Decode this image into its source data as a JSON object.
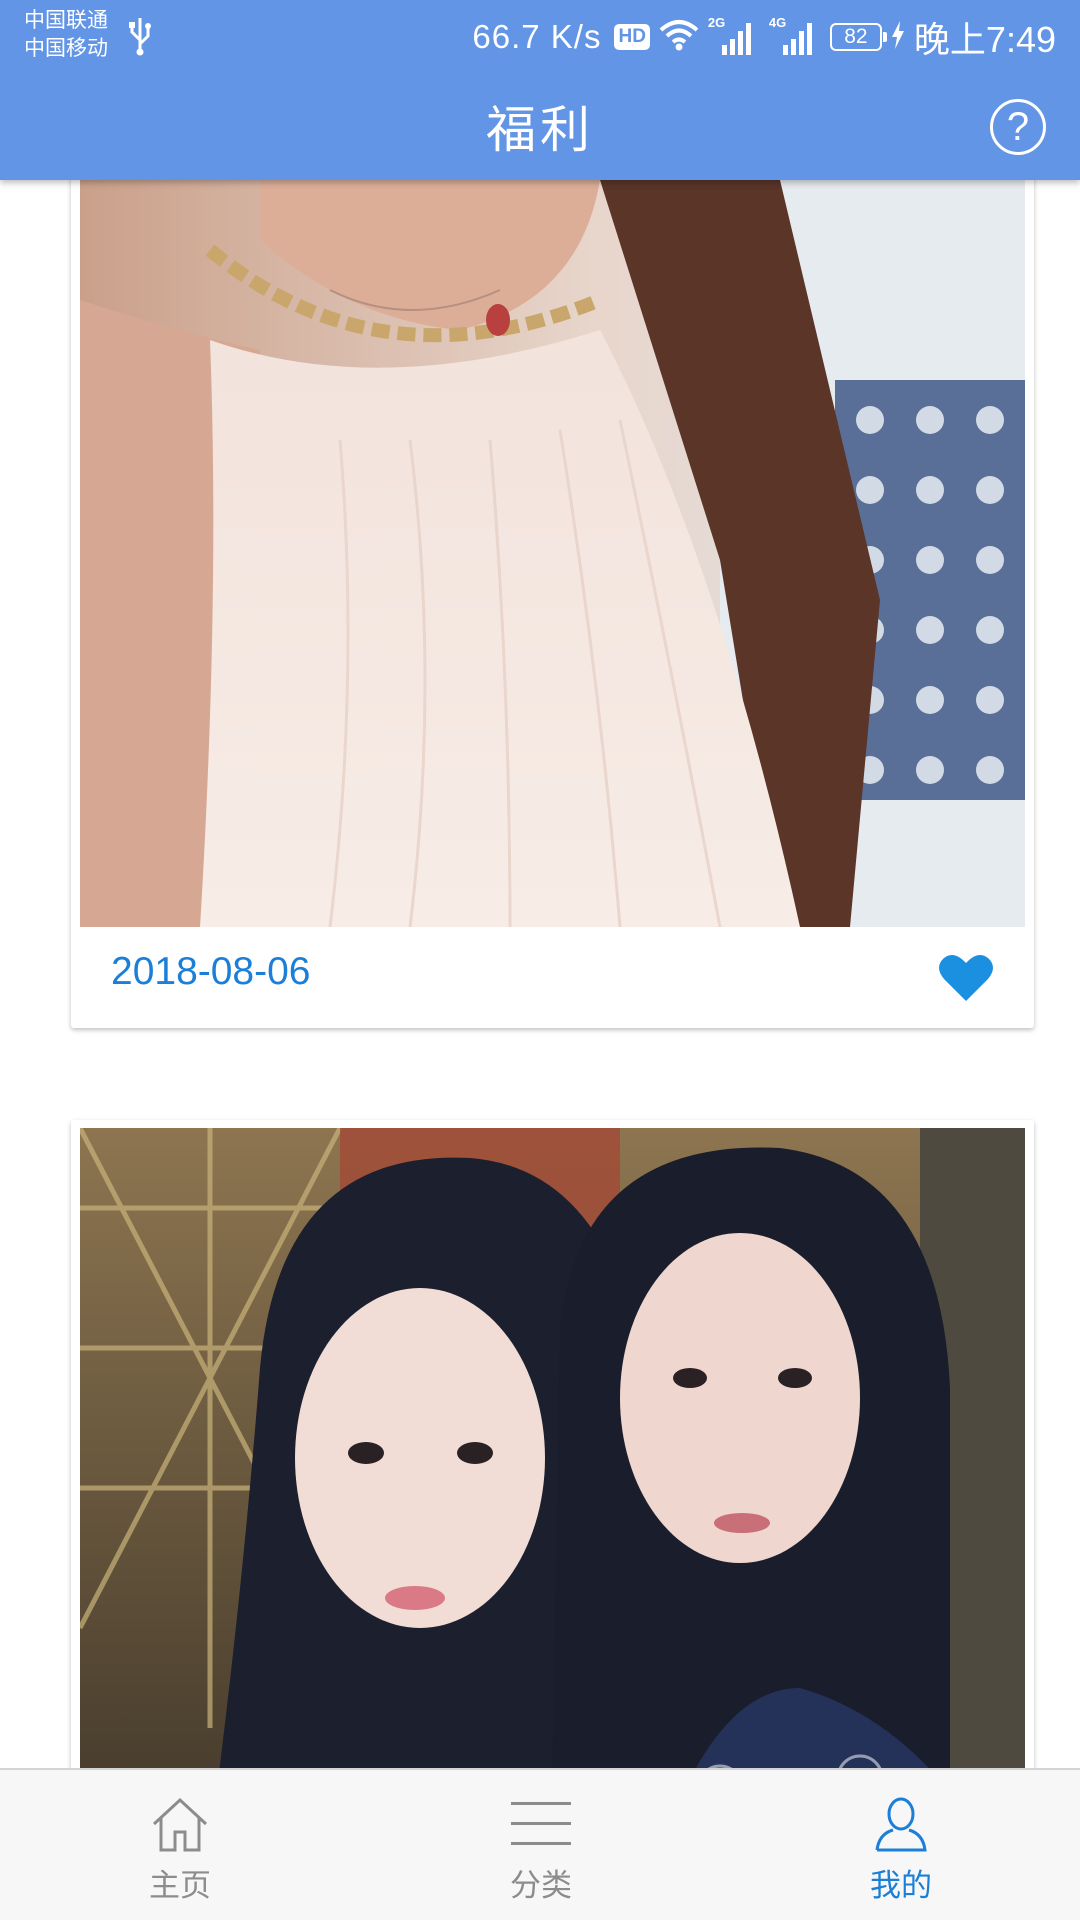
{
  "status_bar": {
    "carrier_1": "中国联通",
    "carrier_2": "中国移动",
    "net_speed": "66.7 K/s",
    "hd_label": "HD",
    "signal_1_tag": "2G",
    "signal_2_tag": "4G",
    "battery": "82",
    "time": "晚上7:49",
    "icons": [
      "usb-icon",
      "wifi-icon",
      "signal-icon",
      "signal-icon",
      "battery-icon",
      "charging-icon"
    ]
  },
  "header": {
    "title": "福利",
    "help_icon_glyph": "?"
  },
  "feed": {
    "cards": [
      {
        "date": "2018-08-06",
        "liked": true
      },
      {
        "date": null,
        "liked": false
      }
    ]
  },
  "bottom_nav": {
    "items": [
      {
        "label": "主页",
        "icon": "home-icon"
      },
      {
        "label": "分类",
        "icon": "menu-icon"
      },
      {
        "label": "我的",
        "icon": "user-icon"
      }
    ],
    "active_index": 2
  },
  "colors": {
    "header_bg": "#6295e6",
    "accent": "#1b7fd8",
    "heart": "#1b8fe0",
    "nav_bg": "#f7f7f7",
    "nav_inactive": "#8c8c8c"
  }
}
